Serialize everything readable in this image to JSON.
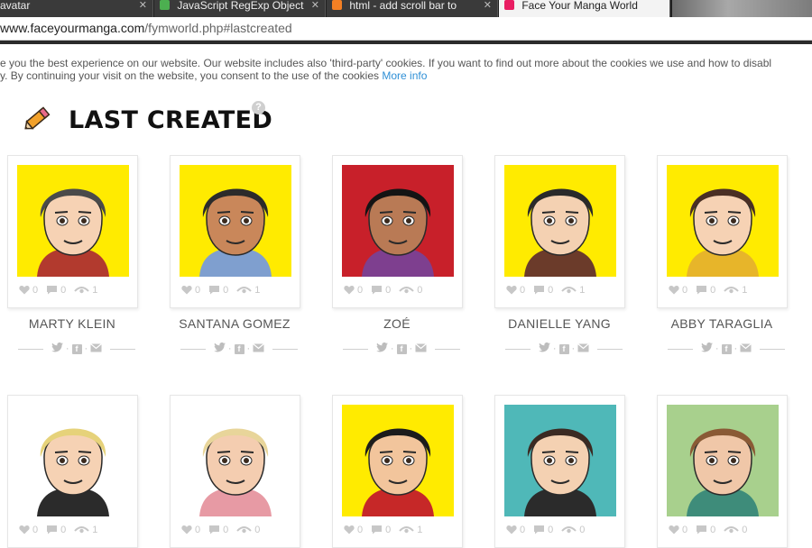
{
  "browser": {
    "tabs": [
      {
        "label": "avatar",
        "active": false,
        "color": "#888888"
      },
      {
        "label": "JavaScript RegExp Object",
        "active": false,
        "color": "#4caf50"
      },
      {
        "label": "html - add scroll bar to",
        "active": false,
        "color": "#f48024"
      },
      {
        "label": "Face Your Manga World",
        "active": true,
        "color": "#e91e63"
      }
    ],
    "url_host": "www.faceyourmanga.com",
    "url_path": "/fymworld.php#lastcreated"
  },
  "cookie_banner": {
    "line1": "ve you the best experience on our website. Our website includes also 'third-party' cookies. If you want to find out more about the cookies we use and how to disabl",
    "line2": "cy. By continuing your visit on the website, you consent to the use of the cookies",
    "more_info": "More info"
  },
  "section": {
    "title": "LAST CREATED",
    "help": "?"
  },
  "colors": {
    "accent_blue": "#2e8fd6",
    "stat_gray": "#c7c7c7"
  },
  "avatars": [
    {
      "name": "MARTY KLEIN",
      "likes": "0",
      "comments": "0",
      "views": "1",
      "bg": "#ffeb00",
      "skin": "#f6d2b4",
      "hair": "#4a4a4a",
      "shirt": "#b23a2e"
    },
    {
      "name": "SANTANA GOMEZ",
      "likes": "0",
      "comments": "0",
      "views": "1",
      "bg": "#ffeb00",
      "skin": "#c9875a",
      "hair": "#2b2b2b",
      "shirt": "#7f9fcf"
    },
    {
      "name": "ZOÉ",
      "likes": "0",
      "comments": "0",
      "views": "0",
      "bg": "#c8202a",
      "skin": "#b97a55",
      "hair": "#141414",
      "shirt": "#7e3f8f"
    },
    {
      "name": "DANIELLE YANG",
      "likes": "0",
      "comments": "0",
      "views": "1",
      "bg": "#ffeb00",
      "skin": "#f4d1b2",
      "hair": "#2a2a2a",
      "shirt": "#6b3b2a"
    },
    {
      "name": "ABBY TARAGLIA",
      "likes": "0",
      "comments": "0",
      "views": "1",
      "bg": "#ffeb00",
      "skin": "#f6d2b4",
      "hair": "#4a2f24",
      "shirt": "#e7b52a"
    },
    {
      "name": "",
      "likes": "0",
      "comments": "0",
      "views": "1",
      "bg": "#ffffff",
      "skin": "#f6d2b4",
      "hair": "#e6d27a",
      "shirt": "#2b2b2b"
    },
    {
      "name": "",
      "likes": "0",
      "comments": "0",
      "views": "0",
      "bg": "#ffffff",
      "skin": "#f4cdb0",
      "hair": "#e8d59a",
      "shirt": "#e79aa4"
    },
    {
      "name": "",
      "likes": "0",
      "comments": "0",
      "views": "1",
      "bg": "#ffeb00",
      "skin": "#f2c59c",
      "hair": "#1c1c1c",
      "shirt": "#c62828"
    },
    {
      "name": "",
      "likes": "0",
      "comments": "0",
      "views": "0",
      "bg": "#4fb8b8",
      "skin": "#f4d1b2",
      "hair": "#3b2a22",
      "shirt": "#2b2b2b"
    },
    {
      "name": "",
      "likes": "0",
      "comments": "0",
      "views": "0",
      "bg": "#a8d08d",
      "skin": "#f0c7a8",
      "hair": "#8a5a35",
      "shirt": "#3e8c7a"
    }
  ]
}
